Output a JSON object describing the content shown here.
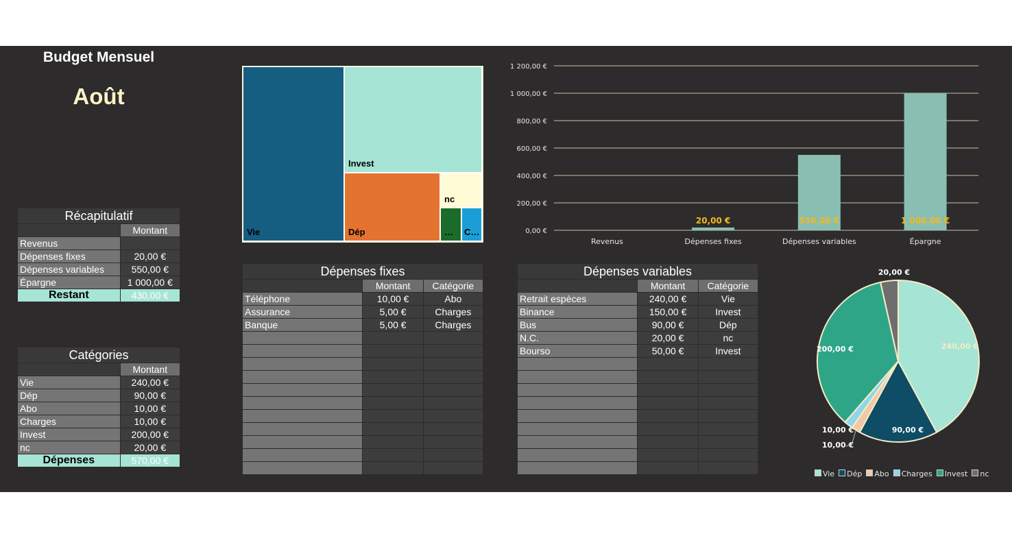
{
  "title": "Budget Mensuel",
  "month": "Août",
  "recap": {
    "title": "Récapitulatif",
    "col": "Montant",
    "rows": [
      {
        "label": "Revenus",
        "value": ""
      },
      {
        "label": "Dépenses fixes",
        "value": "20,00 €"
      },
      {
        "label": "Dépenses variables",
        "value": "550,00 €"
      },
      {
        "label": "Épargne",
        "value": "1 000,00 €"
      }
    ],
    "total_label": "Restant",
    "total_value": "430,00 €"
  },
  "categories": {
    "title": "Catégories",
    "col": "Montant",
    "rows": [
      {
        "label": "Vie",
        "value": "240,00 €"
      },
      {
        "label": "Dép",
        "value": "90,00 €"
      },
      {
        "label": "Abo",
        "value": "10,00 €"
      },
      {
        "label": "Charges",
        "value": "10,00 €"
      },
      {
        "label": "Invest",
        "value": "200,00 €"
      },
      {
        "label": "nc",
        "value": "20,00 €"
      }
    ],
    "total_label": "Dépenses",
    "total_value": "570,00 €"
  },
  "fixed": {
    "title": "Dépenses fixes",
    "cols": [
      "Montant",
      "Catégorie"
    ],
    "rows": [
      {
        "label": "Téléphone",
        "amount": "10,00 €",
        "cat": "Abo"
      },
      {
        "label": "Assurance",
        "amount": "5,00 €",
        "cat": "Charges"
      },
      {
        "label": "Banque",
        "amount": "5,00 €",
        "cat": "Charges"
      }
    ]
  },
  "variable": {
    "title": "Dépenses variables",
    "cols": [
      "Montant",
      "Catégorie"
    ],
    "rows": [
      {
        "label": "Retrait espèces",
        "amount": "240,00 €",
        "cat": "Vie"
      },
      {
        "label": "Binance",
        "amount": "150,00 €",
        "cat": "Invest"
      },
      {
        "label": "Bus",
        "amount": "90,00 €",
        "cat": "Dép"
      },
      {
        "label": "N.C.",
        "amount": "20,00 €",
        "cat": "nc"
      },
      {
        "label": "Bourso",
        "amount": "50,00 €",
        "cat": "Invest"
      }
    ]
  },
  "chart_data": [
    {
      "type": "treemap",
      "labels": [
        "Vie",
        "Invest",
        "Dép",
        "nc",
        "…",
        "C…"
      ],
      "values": [
        240,
        200,
        90,
        20,
        10,
        10
      ],
      "colors": [
        "#155e82",
        "#a6e4d5",
        "#e57330",
        "#fffbd4",
        "#1b6b2a",
        "#1b9ed8"
      ]
    },
    {
      "type": "bar",
      "categories": [
        "Revenus",
        "Dépenses fixes",
        "Dépenses variables",
        "Épargne"
      ],
      "values": [
        0,
        20,
        550,
        1000
      ],
      "data_labels": [
        "",
        "20,00 €",
        "550,00 €",
        "1 000,00 €"
      ],
      "yticks": [
        "0,00 €",
        "200,00 €",
        "400,00 €",
        "600,00 €",
        "800,00 €",
        "1 000,00 €",
        "1 200,00 €"
      ],
      "ylim": [
        0,
        1200
      ],
      "bar_color": "#89bfb2",
      "label_color": "#f5b820",
      "grid": true
    },
    {
      "type": "pie",
      "labels": [
        "Vie",
        "Dép",
        "Abo",
        "Charges",
        "Invest",
        "nc"
      ],
      "values": [
        240,
        90,
        10,
        10,
        200,
        20
      ],
      "data_labels": [
        "240,00 €",
        "90,00 €",
        "10,00 €",
        "10,00 €",
        "200,00 €",
        "20,00 €"
      ],
      "colors": [
        "#a6e4d5",
        "#0f4c66",
        "#f2c7a8",
        "#8fd6ea",
        "#2fa588",
        "#6f6e6e"
      ],
      "legend": "bottom"
    }
  ]
}
